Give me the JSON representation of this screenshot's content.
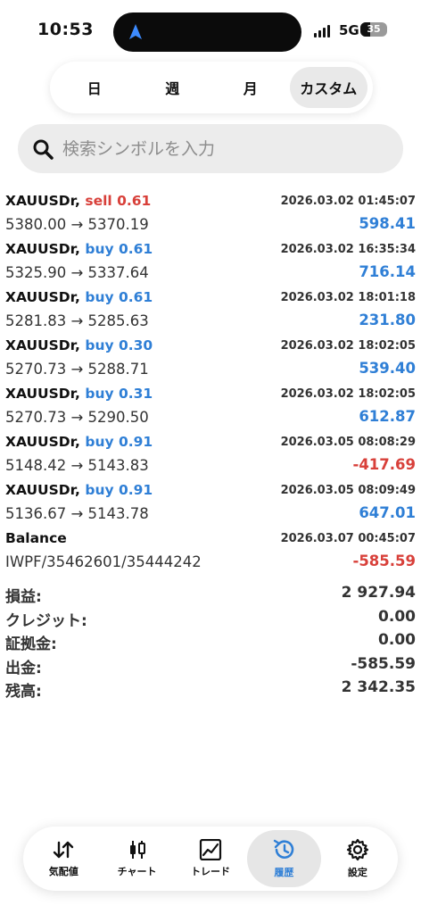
{
  "status": {
    "time": "10:53",
    "network": "5G",
    "battery": "35"
  },
  "tabs": [
    {
      "label": "日",
      "active": false
    },
    {
      "label": "週",
      "active": false
    },
    {
      "label": "月",
      "active": false
    },
    {
      "label": "カスタム",
      "active": true
    }
  ],
  "search": {
    "placeholder": "検索シンボルを入力"
  },
  "deals": [
    {
      "symbol": "XAUUSDr,",
      "side": "sell 0.61",
      "type": "sell",
      "time": "2026.03.02 01:45:07",
      "prices": "5380.00 → 5370.19",
      "profit": "598.41",
      "sign": "pos"
    },
    {
      "symbol": "XAUUSDr,",
      "side": "buy 0.61",
      "type": "buy",
      "time": "2026.03.02 16:35:34",
      "prices": "5325.90 → 5337.64",
      "profit": "716.14",
      "sign": "pos"
    },
    {
      "symbol": "XAUUSDr,",
      "side": "buy 0.61",
      "type": "buy",
      "time": "2026.03.02 18:01:18",
      "prices": "5281.83 → 5285.63",
      "profit": "231.80",
      "sign": "pos"
    },
    {
      "symbol": "XAUUSDr,",
      "side": "buy 0.30",
      "type": "buy",
      "time": "2026.03.02 18:02:05",
      "prices": "5270.73 → 5288.71",
      "profit": "539.40",
      "sign": "pos"
    },
    {
      "symbol": "XAUUSDr,",
      "side": "buy 0.31",
      "type": "buy",
      "time": "2026.03.02 18:02:05",
      "prices": "5270.73 → 5290.50",
      "profit": "612.87",
      "sign": "pos"
    },
    {
      "symbol": "XAUUSDr,",
      "side": "buy 0.91",
      "type": "buy",
      "time": "2026.03.05 08:08:29",
      "prices": "5148.42 → 5143.83",
      "profit": "-417.69",
      "sign": "neg"
    },
    {
      "symbol": "XAUUSDr,",
      "side": "buy 0.91",
      "type": "buy",
      "time": "2026.03.05 08:09:49",
      "prices": "5136.67 → 5143.78",
      "profit": "647.01",
      "sign": "pos"
    },
    {
      "symbol": "Balance",
      "side": "",
      "type": "",
      "time": "2026.03.07 00:45:07",
      "prices": "IWPF/35462601/35444242",
      "profit": "-585.59",
      "sign": "neg"
    }
  ],
  "summary": [
    {
      "label": "損益:",
      "value": "2 927.94"
    },
    {
      "label": "クレジット:",
      "value": "0.00"
    },
    {
      "label": "証拠金:",
      "value": "0.00"
    },
    {
      "label": "出金:",
      "value": "-585.59"
    },
    {
      "label": "残高:",
      "value": "2 342.35"
    }
  ],
  "nav": [
    {
      "label": "気配値",
      "icon": "quotes-icon",
      "active": false
    },
    {
      "label": "チャート",
      "icon": "chart-icon",
      "active": false
    },
    {
      "label": "トレード",
      "icon": "trade-icon",
      "active": false
    },
    {
      "label": "履歴",
      "icon": "history-icon",
      "active": true
    },
    {
      "label": "設定",
      "icon": "settings-icon",
      "active": false
    }
  ],
  "colors": {
    "buy": "#2f7fd6",
    "sell": "#d8403a",
    "profit_pos": "#2f7fd6",
    "profit_neg": "#d8403a"
  }
}
